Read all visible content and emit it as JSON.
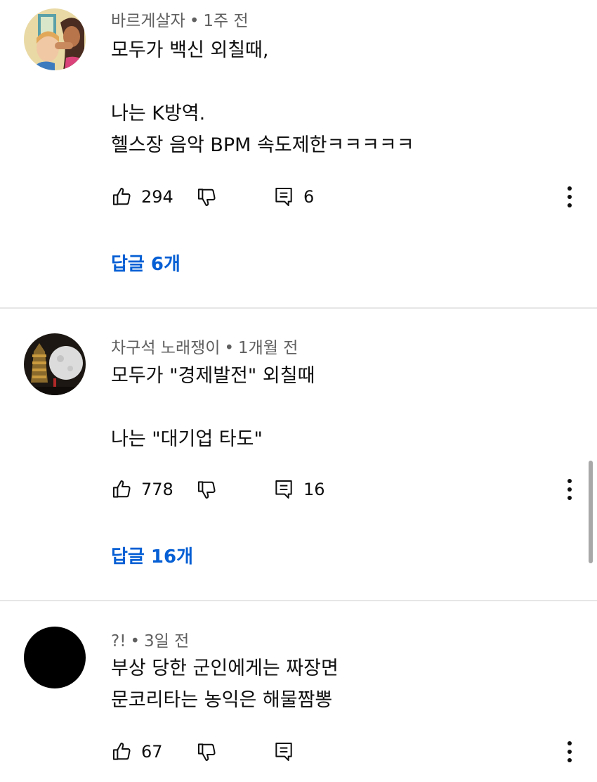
{
  "comments": [
    {
      "author": "바르게살자",
      "time": "1주 전",
      "body": "모두가 백신 외칠때,\n\n나는 K방역.\n헬스장 음악 BPM 속도제한ㅋㅋㅋㅋㅋ",
      "likes": "294",
      "reply_count": "6",
      "replies_label": "답글 6개"
    },
    {
      "author": "차구석 노래쟁이",
      "time": "1개월 전",
      "body": "모두가 \"경제발전\" 외칠때\n\n나는 \"대기업 타도\"",
      "likes": "778",
      "reply_count": "16",
      "replies_label": "답글 16개"
    },
    {
      "author": "?!",
      "time": "3일 전",
      "body": "부상 당한 군인에게는 짜장면\n문코리타는 농익은 해물짬뽕",
      "likes": "67"
    }
  ],
  "meta_separator": "•",
  "icons": {
    "like": "thumbs-up-icon",
    "dislike": "thumbs-down-icon",
    "reply": "comment-icon",
    "more": "more-vertical-icon"
  },
  "colors": {
    "link_blue": "#065fd4",
    "meta_gray": "#606060",
    "divider": "#e6e6e6"
  }
}
